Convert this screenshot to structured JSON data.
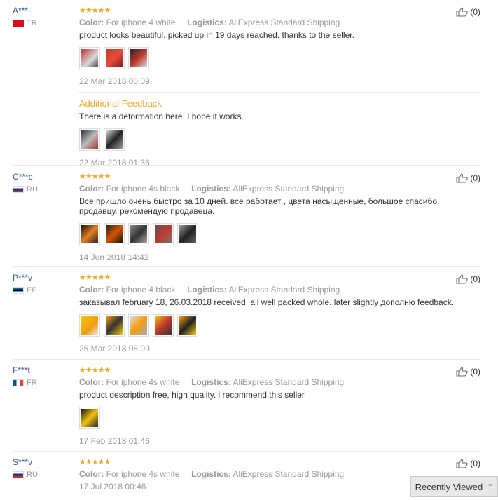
{
  "labels": {
    "color": "Color:",
    "logistics": "Logistics:",
    "additional": "Additional Feedback",
    "recently_viewed": "Recently Viewed"
  },
  "reviews": [
    {
      "user": "A***L",
      "country": "TR",
      "stars": "★★★★★",
      "color_value": "For iphone 4 white",
      "logistics_value": "AliExpress Standard Shipping",
      "text": "product looks beautiful. picked up in 19 days reached. thanks to the seller.",
      "date": "22 Mar 2018 00:09",
      "helpful": "(0)",
      "additional_text": "There is a deformation here. I hope it works.",
      "additional_date": "22 Mar 2018 01:36"
    },
    {
      "user": "C***c",
      "country": "RU",
      "stars": "★★★★★",
      "color_value": "For iphone 4s black",
      "logistics_value": "AliExpress Standard Shipping",
      "text": "Все пришло очень быстро за 10 дней. все работает , цвета насыщенные, большое спасибо продавцу. рекомендую продавеца.",
      "date": "14 Jun 2018 14:42",
      "helpful": "(0)"
    },
    {
      "user": "P***v",
      "country": "EE",
      "stars": "★★★★★",
      "color_value": "For iphone 4 black",
      "logistics_value": "AliExpress Standard Shipping",
      "text": "заказывал february 18, 26.03.2018 received. all well packed whole. later slightly дополню feedback.",
      "date": "26 Mar 2018 08:00",
      "helpful": "(0)"
    },
    {
      "user": "F***t",
      "country": "FR",
      "stars": "★★★★★",
      "color_value": "For iphone 4s white",
      "logistics_value": "AliExpress Standard Shipping",
      "text": "product description free, high quality. i recommend this seller",
      "date": "17 Feb 2018 01:46",
      "helpful": "(0)"
    },
    {
      "user": "S***v",
      "country": "RU",
      "stars": "★★★★★",
      "color_value": "For iphone 4s white",
      "logistics_value": "AliExpress Standard Shipping",
      "date": "17 Jul 2018 00:46",
      "helpful": "(0)"
    }
  ],
  "colors": {
    "username": "#2c5aa0",
    "stars": "#f5a623",
    "additional": "#f5a623"
  }
}
